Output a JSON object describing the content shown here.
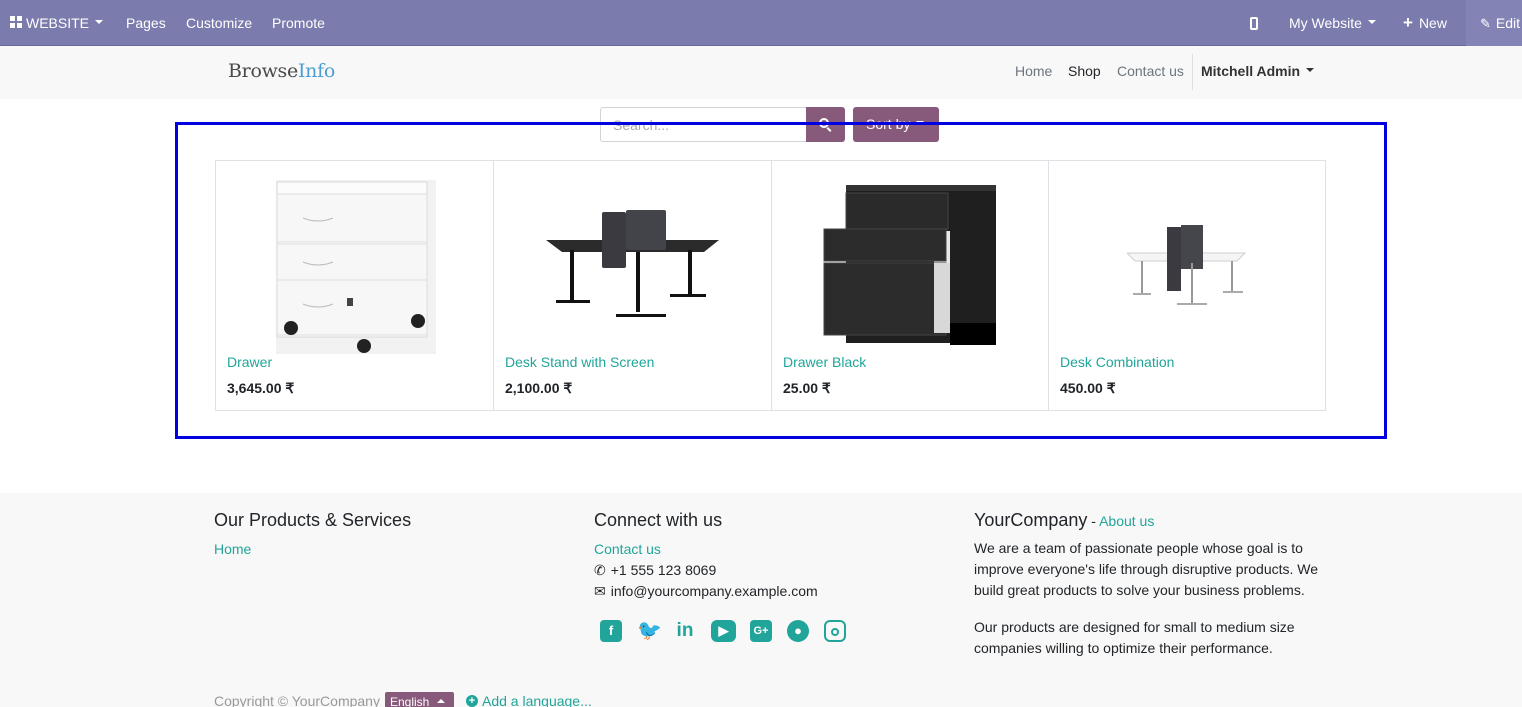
{
  "admin_bar": {
    "website_label": "WEBSITE",
    "pages_label": "Pages",
    "customize_label": "Customize",
    "promote_label": "Promote",
    "my_website_label": "My Website",
    "new_label": "New",
    "edit_label": "Edit"
  },
  "header": {
    "logo_part1": "Browse",
    "logo_part2": "Info",
    "nav": [
      "Home",
      "Shop",
      "Contact us"
    ],
    "user_label": "Mitchell Admin"
  },
  "search": {
    "placeholder": "Search...",
    "sort_label": "Sort by"
  },
  "products": [
    {
      "name": "Drawer",
      "price": "3,645.00 ₹"
    },
    {
      "name": "Desk Stand with Screen",
      "price": "2,100.00 ₹"
    },
    {
      "name": "Drawer Black",
      "price": "25.00 ₹"
    },
    {
      "name": "Desk Combination",
      "price": "450.00 ₹"
    }
  ],
  "footer": {
    "col1_title": "Our Products & Services",
    "col1_link": "Home",
    "col2_title": "Connect with us",
    "col2_link": "Contact us",
    "phone": "+1 555 123 8069",
    "email": "info@yourcompany.example.com",
    "col3_title": "YourCompany",
    "col3_sep": " - ",
    "col3_link": "About us",
    "para1": "We are a team of passionate people whose goal is to improve everyone's life through disruptive products. We build great products to solve your business problems.",
    "para2": "Our products are designed for small to medium size companies willing to optimize their performance.",
    "copyright": "Copyright © YourCompany",
    "language": "English",
    "add_language": "Add a language..."
  },
  "colors": {
    "admin_bar": "#7c7bad",
    "primary": "#875a7b",
    "link": "#21a59a",
    "highlight": "#0000e0"
  },
  "icons": [
    "apps-icon",
    "phone-icon",
    "plus-icon",
    "pencil-icon",
    "search-icon",
    "facebook-icon",
    "twitter-icon",
    "linkedin-icon",
    "youtube-icon",
    "googleplus-icon",
    "github-icon",
    "instagram-icon"
  ]
}
